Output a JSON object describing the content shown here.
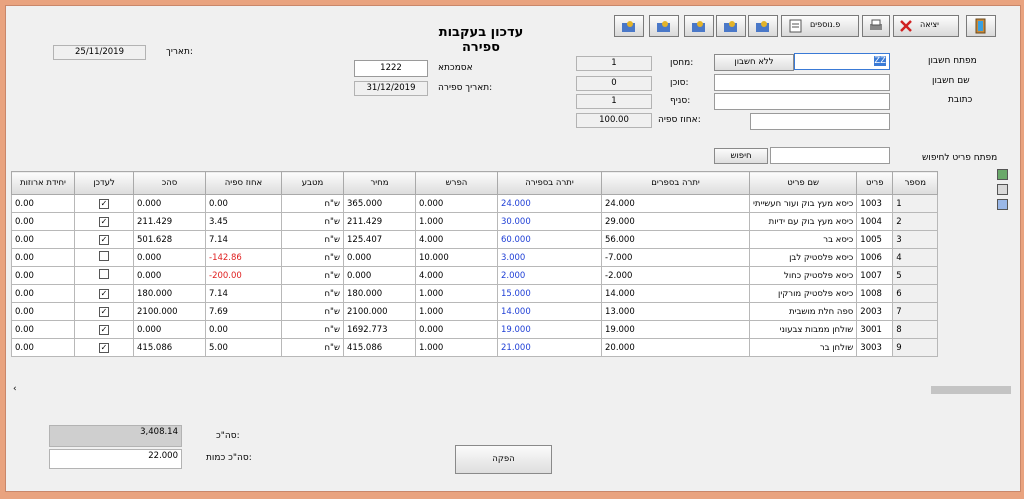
{
  "title": "עדכון בעקבות ספירה",
  "toolbar": {
    "exit_label": "יציאה",
    "details_label": "פ.נוספים"
  },
  "header": {
    "date_label": "תאריך:",
    "date_value": "25/11/2019",
    "document_label": "אסמכתא",
    "document_value": "1222",
    "count_date_label": "תאריך ספירה:",
    "count_date_value": "31/12/2019",
    "warehouse_label": "מחסן:",
    "warehouse_value": "1",
    "agent_label": "סוכן:",
    "agent_value": "0",
    "branch_label": "סניף:",
    "branch_value": "1",
    "percent_label": "אחוז ספיה:",
    "percent_value": "100.00",
    "account_key_label": "מפתח חשבון",
    "account_key_value": "ZZ",
    "no_account_button": "ללא חשבון",
    "account_name_label": "שם חשבון",
    "address_label": "כתובת",
    "item_search_label": "מפתח פריט לחיפוש",
    "search_button": "חיפוש"
  },
  "table": {
    "columns": [
      "מספר",
      "פריט",
      "שם פריט",
      "יתרה בספרים",
      "יתרה בספירה",
      "הפרש",
      "מחיר",
      "מטבע",
      "אחוז ספיה",
      "סהכ",
      "לעדכן",
      "יחידת ארוזות"
    ],
    "rows": [
      {
        "n": "1",
        "item": "1003",
        "name": "כיסא מעץ בוק ועור חעשייתי",
        "book": "24.000",
        "count": "24.000",
        "diff": "0.000",
        "price": "365.000",
        "cur": "ש\"ח",
        "pct": "0.00",
        "total": "0.000",
        "upd": true,
        "unit": "0.00",
        "red": false
      },
      {
        "n": "2",
        "item": "1004",
        "name": "כיסא מעץ בוק עם ידיות",
        "book": "29.000",
        "count": "30.000",
        "diff": "1.000",
        "price": "211.429",
        "cur": "ש\"ח",
        "pct": "3.45",
        "total": "211.429",
        "upd": true,
        "unit": "0.00",
        "red": false
      },
      {
        "n": "3",
        "item": "1005",
        "name": "כיסא בר",
        "book": "56.000",
        "count": "60.000",
        "diff": "4.000",
        "price": "125.407",
        "cur": "ש\"ח",
        "pct": "7.14",
        "total": "501.628",
        "upd": true,
        "unit": "0.00",
        "red": false
      },
      {
        "n": "4",
        "item": "1006",
        "name": "כיסא פלסטיק לבן",
        "book": "-7.000",
        "count": "3.000",
        "diff": "10.000",
        "price": "0.000",
        "cur": "ש\"ח",
        "pct": "-142.86",
        "total": "0.000",
        "upd": false,
        "unit": "0.00",
        "red": true
      },
      {
        "n": "5",
        "item": "1007",
        "name": "כיסא פלסטיק כחול",
        "book": "-2.000",
        "count": "2.000",
        "diff": "4.000",
        "price": "0.000",
        "cur": "ש\"ח",
        "pct": "-200.00",
        "total": "0.000",
        "upd": false,
        "unit": "0.00",
        "red": true
      },
      {
        "n": "6",
        "item": "1008",
        "name": "כיסא פלסטיק מורקין",
        "book": "14.000",
        "count": "15.000",
        "diff": "1.000",
        "price": "180.000",
        "cur": "ש\"ח",
        "pct": "7.14",
        "total": "180.000",
        "upd": true,
        "unit": "0.00",
        "red": false
      },
      {
        "n": "7",
        "item": "2003",
        "name": "ספה חלת מושבית",
        "book": "13.000",
        "count": "14.000",
        "diff": "1.000",
        "price": "2100.000",
        "cur": "ש\"ח",
        "pct": "7.69",
        "total": "2100.000",
        "upd": true,
        "unit": "0.00",
        "red": false
      },
      {
        "n": "8",
        "item": "3001",
        "name": "שולחן ממבות צבעוני",
        "book": "19.000",
        "count": "19.000",
        "diff": "0.000",
        "price": "1692.773",
        "cur": "ש\"ח",
        "pct": "0.00",
        "total": "0.000",
        "upd": true,
        "unit": "0.00",
        "red": false
      },
      {
        "n": "9",
        "item": "3003",
        "name": "שולחן בר",
        "book": "20.000",
        "count": "21.000",
        "diff": "1.000",
        "price": "415.086",
        "cur": "ש\"ח",
        "pct": "5.00",
        "total": "415.086",
        "upd": true,
        "unit": "0.00",
        "red": false
      }
    ]
  },
  "footer": {
    "total_label": "סה\"כ:",
    "total_value": "3,408.14",
    "qty_label": "סה\"כ כמות:",
    "qty_value": "22.000",
    "produce_button": "הפקה"
  },
  "colors": {
    "window_frame": "#e9a37f",
    "blue_value": "#1f3fd6",
    "red_value": "#e02020"
  }
}
